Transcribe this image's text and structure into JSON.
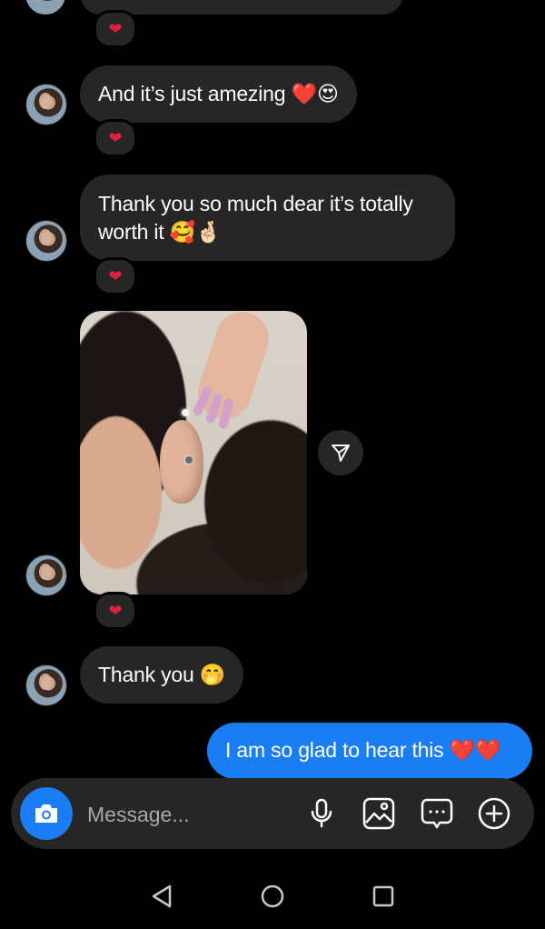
{
  "thread": {
    "messages": [
      {
        "direction": "incoming",
        "text": "And it’s just amezing ❤️😍",
        "reaction": "❤"
      },
      {
        "direction": "incoming",
        "text": "Thank you so much dear it’s totally worth it 🥰🤞🏻",
        "reaction": "❤"
      },
      {
        "direction": "incoming",
        "type": "photo",
        "reaction": "❤"
      },
      {
        "direction": "incoming",
        "text": "Thank you 🤭"
      },
      {
        "direction": "outgoing",
        "text": "I am so glad to hear this ❤️❤️"
      }
    ],
    "top_reaction": "❤"
  },
  "composer": {
    "placeholder": "Message...",
    "icons": [
      "camera-icon",
      "microphone-icon",
      "gallery-icon",
      "sticker-chat-icon",
      "add-icon"
    ]
  },
  "navigation": {
    "icons": [
      "back-triangle-icon",
      "home-circle-icon",
      "recents-square-icon"
    ]
  },
  "colors": {
    "background": "#000000",
    "incoming_bubble": "#262626",
    "outgoing_bubble": "#1a7ef2",
    "reaction_heart": "#e0213b"
  }
}
